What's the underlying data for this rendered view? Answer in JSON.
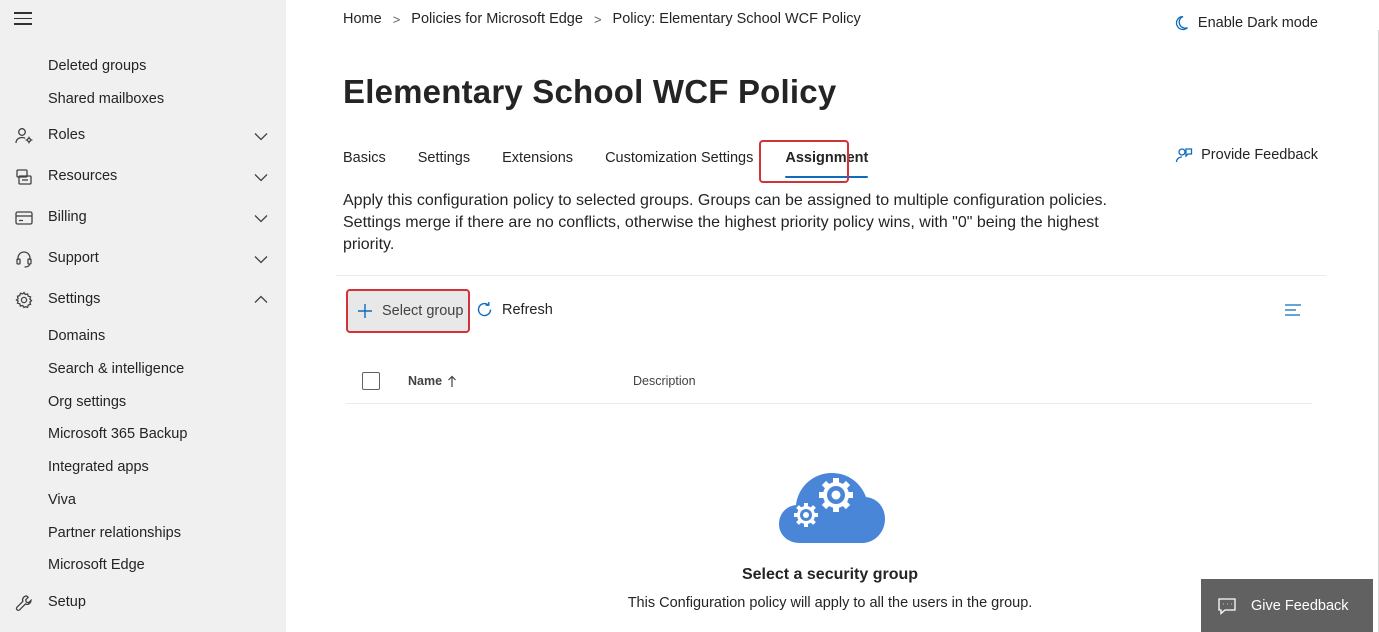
{
  "sidebar": {
    "sub_items_top": [
      "Deleted groups",
      "Shared mailboxes"
    ],
    "nav": [
      {
        "label": "Roles",
        "icon": "roles-icon",
        "expanded": false
      },
      {
        "label": "Resources",
        "icon": "resources-icon",
        "expanded": false
      },
      {
        "label": "Billing",
        "icon": "billing-icon",
        "expanded": false
      },
      {
        "label": "Support",
        "icon": "headset-icon",
        "expanded": false
      },
      {
        "label": "Settings",
        "icon": "gear-icon",
        "expanded": true
      }
    ],
    "settings_items": [
      "Domains",
      "Search & intelligence",
      "Org settings",
      "Microsoft 365 Backup",
      "Integrated apps",
      "Viva",
      "Partner relationships",
      "Microsoft Edge"
    ],
    "setup": {
      "label": "Setup",
      "icon": "wrench-icon"
    }
  },
  "breadcrumb": {
    "home": "Home",
    "policies": "Policies for Microsoft Edge",
    "current": "Policy: Elementary School WCF Policy",
    "separator": ">"
  },
  "darkmode_label": "Enable Dark mode",
  "page_title": "Elementary School WCF Policy",
  "tabs": [
    "Basics",
    "Settings",
    "Extensions",
    "Customization Settings",
    "Assignment"
  ],
  "active_tab": "Assignment",
  "provide_feedback": "Provide Feedback",
  "description": "Apply this configuration policy to selected groups. Groups can be assigned to multiple configuration policies. Settings merge if there are no conflicts, otherwise the highest priority policy wins, with \"0\" being the highest priority.",
  "toolbar": {
    "select_group": "Select group",
    "refresh": "Refresh"
  },
  "table": {
    "col_name": "Name",
    "col_description": "Description",
    "sort": "ascending"
  },
  "empty_state": {
    "title": "Select a security group",
    "subtitle": "This Configuration policy will apply to all the users in the group."
  },
  "give_feedback": "Give Feedback",
  "colors": {
    "accent": "#0f6cbd",
    "highlight": "#d13438",
    "sidebar_bg": "#f0f0f0",
    "cloud": "#4a86d8"
  }
}
